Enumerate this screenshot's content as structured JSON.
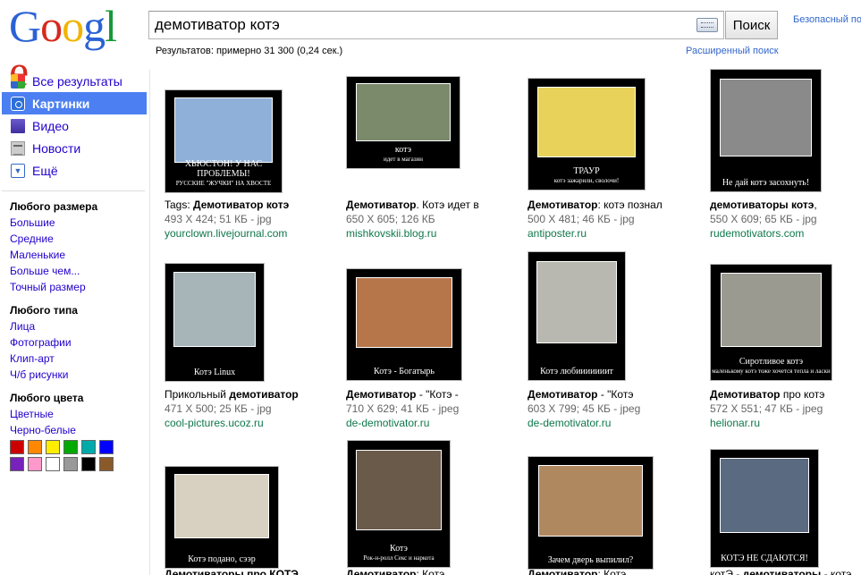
{
  "logo": [
    "G",
    "o",
    "o",
    "g",
    "l",
    "e"
  ],
  "logo_colors": [
    "#2a62d6",
    "#d62a1e",
    "#f0b400",
    "#2a62d6",
    "#159a37",
    "#d62a1e"
  ],
  "search": {
    "query": "демотиватор котэ",
    "button": "Поиск"
  },
  "safesearch": "Безопасный по",
  "stats": "Результатов: примерно 31 300 (0,24 сек.)",
  "advanced": "Расширенный поиск",
  "nav": [
    {
      "label": "Все результаты",
      "icon": "all-results-icon",
      "active": false
    },
    {
      "label": "Картинки",
      "icon": "images-icon",
      "active": true
    },
    {
      "label": "Видео",
      "icon": "video-icon",
      "active": false
    },
    {
      "label": "Новости",
      "icon": "news-icon",
      "active": false
    },
    {
      "label": "Ещё",
      "icon": "more-icon",
      "active": false
    }
  ],
  "filters": {
    "size_head": "Любого размера",
    "size": [
      "Большие",
      "Средние",
      "Маленькие",
      "Больше чем...",
      "Точный размер"
    ],
    "type_head": "Любого типа",
    "type": [
      "Лица",
      "Фотографии",
      "Клип-арт",
      "Ч/б рисунки"
    ],
    "color_head": "Любого цвета",
    "color": [
      "Цветные",
      "Черно-белые"
    ],
    "swatches": [
      "#cc0000",
      "#ff8800",
      "#ffee00",
      "#00aa00",
      "#00aaaa",
      "#0000ff",
      "#7722bb",
      "#ff99cc",
      "#ffffff",
      "#999999",
      "#000000",
      "#8b5a2b"
    ]
  },
  "results": [
    {
      "title_pre": "Tags: ",
      "title_bold": "Демотиватор котэ",
      "title_post": "",
      "size": "493 X 424; 51 КБ - jpg",
      "url": "yourclown.livejournal.com",
      "caption": "ХЬЮСТОН! У НАС ПРОБЛЕМЫ!\nРУССКИЕ \"ЖУЧКИ\" НА ХВОСТЕ",
      "pic": "#8fb0d8"
    },
    {
      "title_pre": "",
      "title_bold": "Демотиватор",
      "title_post": ". Котэ идет в",
      "size": "650 X 605; 126 КБ",
      "url": "mishkovskii.blog.ru",
      "caption": "котэ\nидет в магазин",
      "pic": "#7a8a6a"
    },
    {
      "title_pre": "",
      "title_bold": "Демотиватор",
      "title_post": ": котэ познал",
      "size": "500 X 481; 46 КБ - jpg",
      "url": "antiposter.ru",
      "caption": "ТРАУР\nкотэ зажарили, сволочи!",
      "pic": "#e8d25a"
    },
    {
      "title_pre": "",
      "title_bold": "демотиваторы котэ",
      "title_post": ",",
      "size": "550 X 609; 65 КБ - jpg",
      "url": "rudemotivators.com",
      "caption": "Не дай котэ засохнуть!",
      "pic": "#8a8a8a"
    },
    {
      "title_pre": "Прикольный ",
      "title_bold": "демотиватор",
      "title_post": "",
      "size": "471 X 500; 25 КБ - jpg",
      "url": "cool-pictures.ucoz.ru",
      "caption": "Котэ Linux",
      "pic": "#a7b4b8"
    },
    {
      "title_pre": "",
      "title_bold": "Демотиватор",
      "title_post": " - \"Котэ -",
      "size": "710 X 629; 41 КБ - jpeg",
      "url": "de-demotivator.ru",
      "caption": "Котэ - Богатырь",
      "pic": "#b7764a"
    },
    {
      "title_pre": "",
      "title_bold": "Демотиватор",
      "title_post": " - \"Котэ",
      "size": "603 X 799; 45 КБ - jpeg",
      "url": "de-demotivator.ru",
      "caption": "Котэ любииииииит",
      "pic": "#b8b8b0"
    },
    {
      "title_pre": "",
      "title_bold": "Демотиватор",
      "title_post": " про котэ",
      "size": "572 X 551; 47 КБ - jpeg",
      "url": "helionar.ru",
      "caption": "Сиротливое котэ\nмаленькому котэ тоже хочется тепла и ласки",
      "pic": "#9a9a90"
    },
    {
      "title_pre": "",
      "title_bold": "Демотиваторы про КОТЭ",
      "title_post": "",
      "size": "",
      "url": "",
      "caption": "Котэ подано, сээр",
      "pic": "#d8d0c0"
    },
    {
      "title_pre": "",
      "title_bold": "Демотиватор",
      "title_post": ": Котэ",
      "size": "",
      "url": "",
      "caption": "Котэ\nРок-н-ролл Секс и наркота",
      "pic": "#6a5a4a"
    },
    {
      "title_pre": "",
      "title_bold": "Демотиватор",
      "title_post": ": Котэ",
      "size": "",
      "url": "",
      "caption": "Зачем дверь выпилил?",
      "pic": "#b08860"
    },
    {
      "title_pre": "котЭ - ",
      "title_bold": "демотиваторы",
      "title_post": " - котэ",
      "size": "",
      "url": "",
      "caption": "КОТЭ НЕ СДАЮТСЯ!",
      "pic": "#5a6a80"
    }
  ]
}
